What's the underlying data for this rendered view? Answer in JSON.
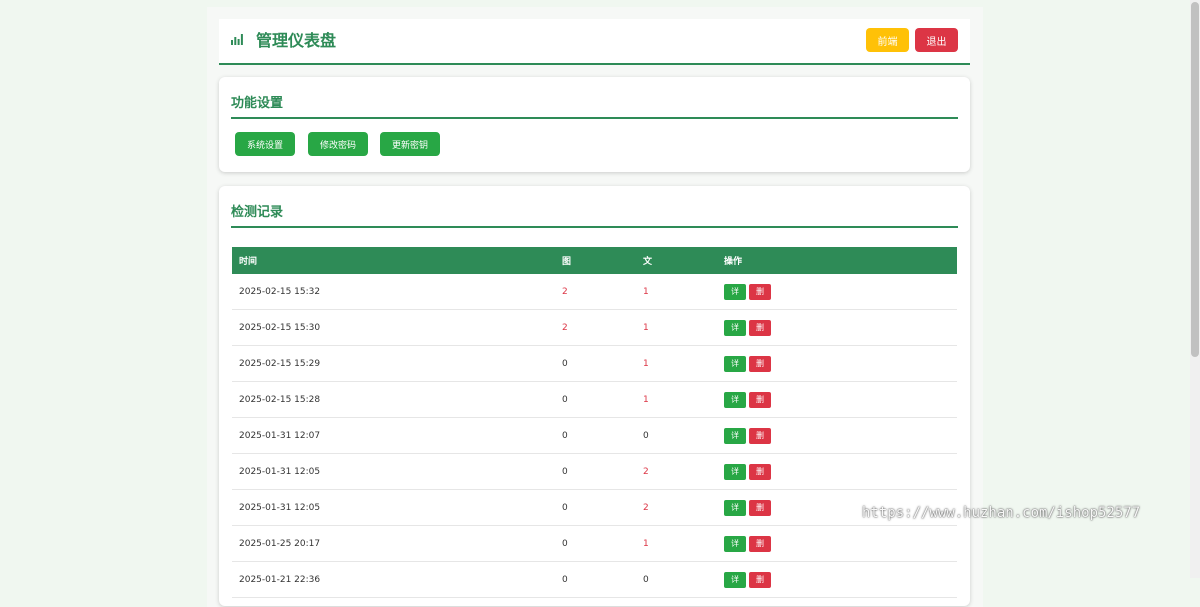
{
  "header": {
    "title": "管理仪表盘",
    "front_label": "前端",
    "logout_label": "退出"
  },
  "functions": {
    "title": "功能设置",
    "buttons": [
      "系统设置",
      "修改密码",
      "更新密钥"
    ]
  },
  "records": {
    "title": "检测记录",
    "columns": [
      "时间",
      "图",
      "文",
      "操作"
    ],
    "rows": [
      {
        "time": "2025-02-15 15:32",
        "img": "2",
        "text": "1"
      },
      {
        "time": "2025-02-15 15:30",
        "img": "2",
        "text": "1"
      },
      {
        "time": "2025-02-15 15:29",
        "img": "0",
        "text": "1"
      },
      {
        "time": "2025-02-15 15:28",
        "img": "0",
        "text": "1"
      },
      {
        "time": "2025-01-31 12:07",
        "img": "0",
        "text": "0"
      },
      {
        "time": "2025-01-31 12:05",
        "img": "0",
        "text": "2"
      },
      {
        "time": "2025-01-31 12:05",
        "img": "0",
        "text": "2"
      },
      {
        "time": "2025-01-25 20:17",
        "img": "0",
        "text": "1"
      },
      {
        "time": "2025-01-21 22:36",
        "img": "0",
        "text": "0"
      }
    ],
    "detail_label": "详",
    "delete_label": "删"
  },
  "watermark": "https://www.huzhan.com/ishop52577",
  "colors": {
    "primary": "#2e8b57",
    "success": "#28a745",
    "danger": "#dc3545",
    "warning": "#ffc107"
  }
}
